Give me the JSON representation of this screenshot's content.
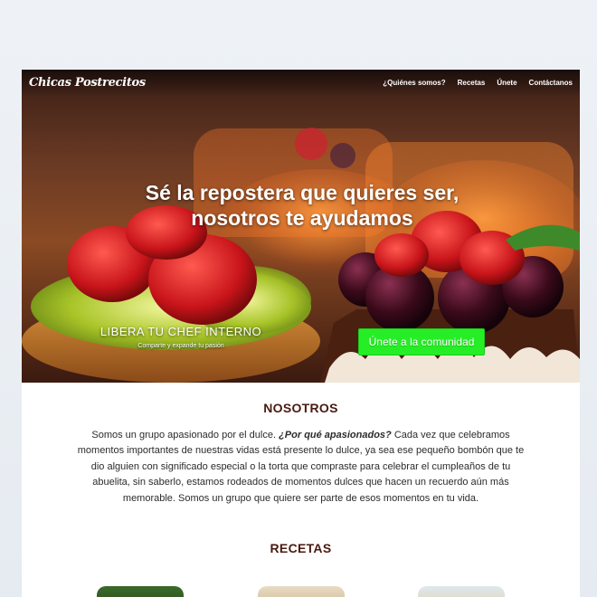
{
  "brand": "Chicas Postrecitos",
  "nav": [
    "¿Quiénes somos?",
    "Recetas",
    "Únete",
    "Contáctanos"
  ],
  "hero": {
    "title_line1": "Sé la repostera que quieres ser,",
    "title_line2": "nosotros te ayudamos",
    "tagline": "LIBERA TU CHEF INTERNO",
    "tagline_sub": "Comparte y expande tu pasión",
    "cta_label": "Únete a la comunidad"
  },
  "about": {
    "title": "NOSOTROS",
    "text_before": "Somos un grupo apasionado por el dulce. ",
    "question": "¿Por qué apasionados?",
    "text_after": " Cada vez que celebramos momentos importantes de nuestras vidas está presente lo dulce, ya sea ese pequeño bombón que te dio alguien con significado especial o la torta que compraste para celebrar el cumpleaños de tu abuelita, sin saberlo, estamos rodeados de momentos dulces que hacen un recuerdo aún más memorable. Somos un grupo que quiere ser parte de esos momentos en tu vida."
  },
  "recipes": {
    "title": "RECETAS"
  },
  "colors": {
    "accent_green": "#26ee26",
    "heading_brown": "#4a1a10"
  }
}
